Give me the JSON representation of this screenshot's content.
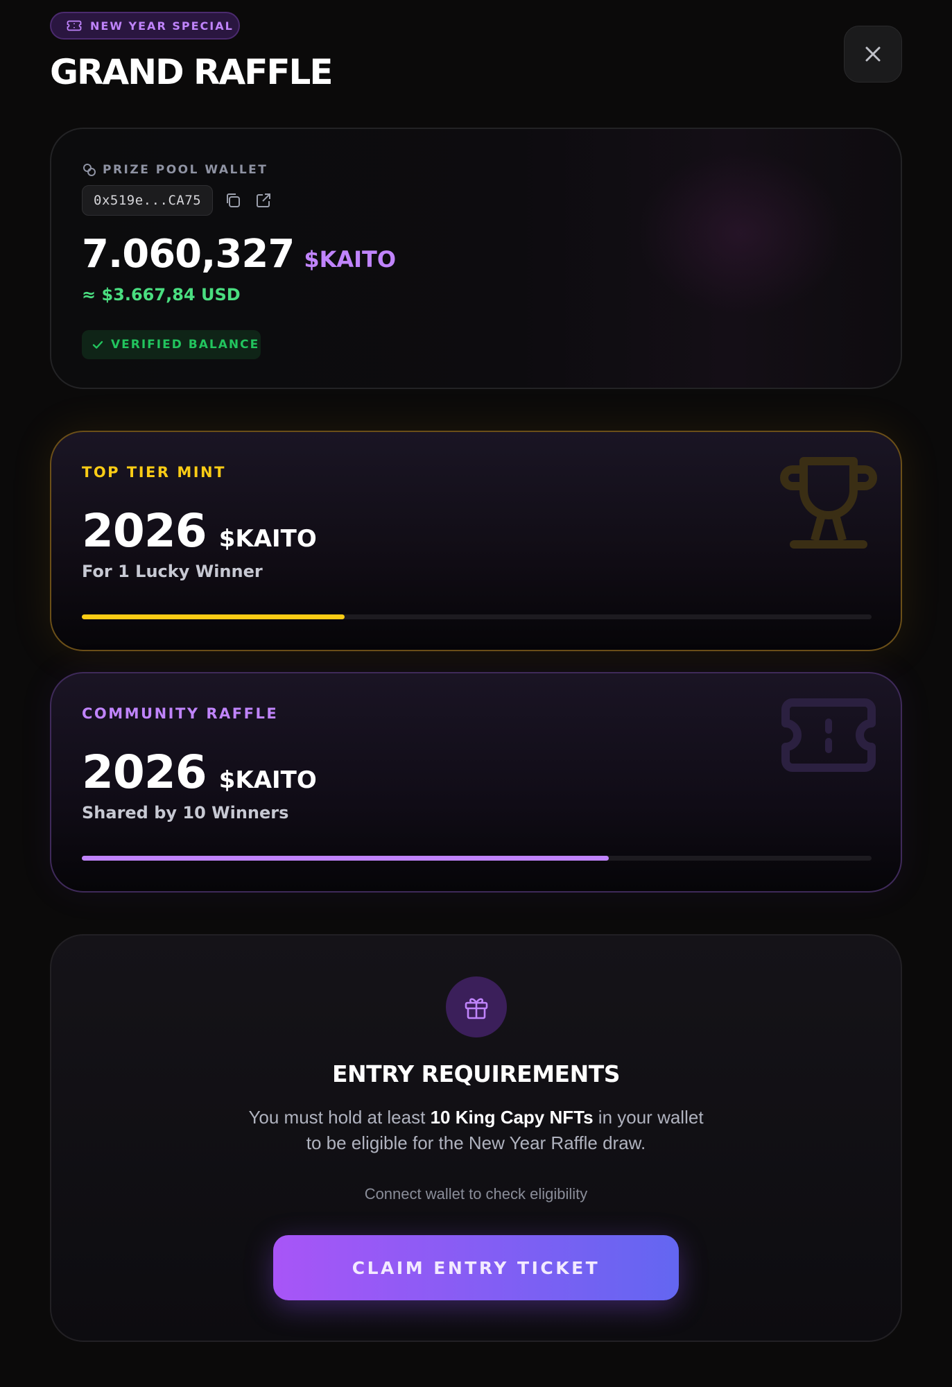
{
  "header": {
    "badge_icon": "ticket-icon",
    "badge_label": "NEW YEAR SPECIAL",
    "title": "GRAND RAFFLE",
    "close_icon": "close-icon"
  },
  "wallet": {
    "label_icon": "link-icon",
    "label": "PRIZE POOL WALLET",
    "address": "0x519e...CA75",
    "copy_icon": "copy-icon",
    "external_icon": "external-link-icon",
    "balance": "7.060,327",
    "token": "$KAITO",
    "usd": "≈ $3.667,84 USD",
    "verified_icon": "check-icon",
    "verified_label": "VERIFIED BALANCE"
  },
  "tiers": [
    {
      "label": "TOP TIER MINT",
      "amount": "2026",
      "token": "$KAITO",
      "subtitle": "For 1 Lucky Winner",
      "icon": "trophy-icon",
      "progress": 0.333,
      "color": "#facc15"
    },
    {
      "label": "COMMUNITY RAFFLE",
      "amount": "2026",
      "token": "$KAITO",
      "subtitle": "Shared by 10 Winners",
      "icon": "ticket-icon",
      "progress": 0.667,
      "color": "#c084fc"
    }
  ],
  "requirements": {
    "icon": "gift-icon",
    "title": "ENTRY REQUIREMENTS",
    "text_before": "You must hold at least ",
    "text_bold": "10 King Capy NFTs",
    "text_after": " in your wallet",
    "text_line2": "to be eligible for the New Year Raffle draw.",
    "hint": "Connect wallet to check eligibility",
    "button_label": "CLAIM ENTRY TICKET"
  },
  "colors": {
    "accent_purple": "#c084fc",
    "accent_gold": "#facc15",
    "success_green": "#22c55e",
    "button_gradient_start": "#a855f7",
    "button_gradient_end": "#6366f1"
  }
}
